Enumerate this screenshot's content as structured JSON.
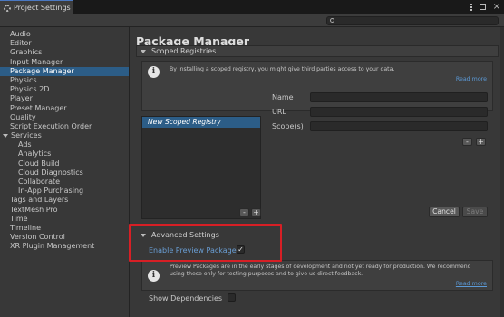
{
  "window": {
    "tab_title": "Project Settings",
    "menu_icon": "kebab-menu-icon",
    "restore_icon": "restore-icon",
    "close_label": "×"
  },
  "search": {
    "placeholder": "",
    "icon": "search-icon"
  },
  "sidebar": {
    "items": [
      {
        "label": "Audio"
      },
      {
        "label": "Editor"
      },
      {
        "label": "Graphics"
      },
      {
        "label": "Input Manager"
      },
      {
        "label": "Package Manager",
        "selected": true
      },
      {
        "label": "Physics"
      },
      {
        "label": "Physics 2D"
      },
      {
        "label": "Player"
      },
      {
        "label": "Preset Manager"
      },
      {
        "label": "Quality"
      },
      {
        "label": "Script Execution Order"
      },
      {
        "label": "Services",
        "expanded": true
      },
      {
        "label": "Ads",
        "child": true
      },
      {
        "label": "Analytics",
        "child": true
      },
      {
        "label": "Cloud Build",
        "child": true
      },
      {
        "label": "Cloud Diagnostics",
        "child": true
      },
      {
        "label": "Collaborate",
        "child": true
      },
      {
        "label": "In-App Purchasing",
        "child": true
      },
      {
        "label": "Tags and Layers"
      },
      {
        "label": "TextMesh Pro"
      },
      {
        "label": "Time"
      },
      {
        "label": "Timeline"
      },
      {
        "label": "Version Control"
      },
      {
        "label": "XR Plugin Management"
      }
    ]
  },
  "main": {
    "title": "Package Manager",
    "scoped": {
      "header": "Scoped Registries",
      "info_text": "By installing a scoped registry, you might give third parties access to your data.",
      "read_more": "Read more",
      "registry_item": "New Scoped Registry",
      "name_label": "Name",
      "url_label": "URL",
      "scopes_label": "Scope(s)",
      "minus": "-",
      "plus": "+",
      "cancel_label": "Cancel",
      "save_label": "Save"
    },
    "advanced": {
      "header": "Advanced Settings",
      "enable_preview_label": "Enable Preview Packages",
      "enable_preview_checked": true,
      "check_mark": "✓",
      "info_line1": "Preview Packages are in the early stages of development and not yet ready for production. We recommend",
      "info_line2": "using these only for testing purposes and to give us direct feedback.",
      "read_more": "Read more",
      "show_dependencies_label": "Show Dependencies",
      "show_dependencies_checked": false
    }
  },
  "colors": {
    "selection": "#2c5d87",
    "highlight_outline": "#d71f25",
    "link": "#5b9ad8",
    "background": "#383838"
  }
}
